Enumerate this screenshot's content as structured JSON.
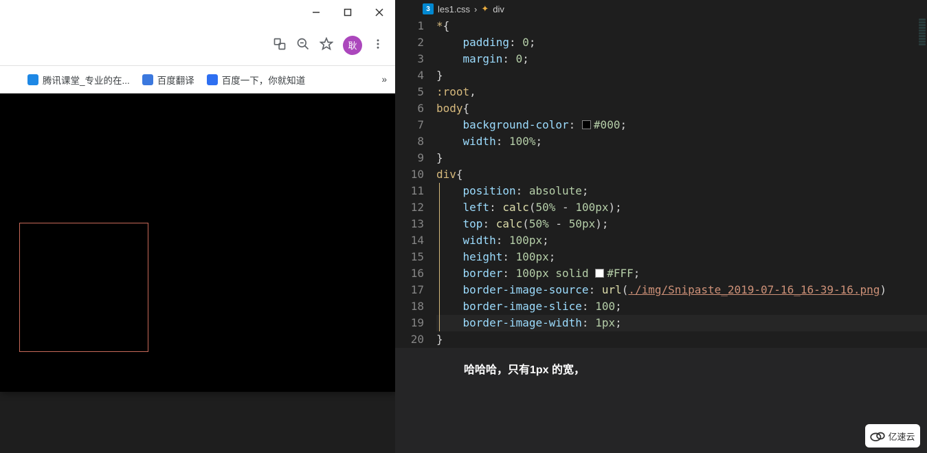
{
  "browser": {
    "bookmarks": [
      {
        "label": "腾讯课堂_专业的在...",
        "color": "#1e88e5"
      },
      {
        "label": "百度翻译",
        "color": "#3b78de"
      },
      {
        "label": "百度一下，你就知道",
        "color": "#2e6ff1"
      }
    ],
    "avatar_char": "耿",
    "overflow": "»"
  },
  "breadcrumb": {
    "file": "les1.css",
    "selector": "div",
    "css_badge": "3",
    "sep": "›"
  },
  "code": {
    "lines": [
      {
        "n": 1,
        "t": [
          [
            "sel",
            "*"
          ],
          [
            "punc",
            "{"
          ]
        ]
      },
      {
        "n": 2,
        "t": [
          [
            "pad",
            "    "
          ],
          [
            "prop",
            "padding"
          ],
          [
            "punc",
            ": "
          ],
          [
            "num",
            "0"
          ],
          [
            "punc",
            ";"
          ]
        ]
      },
      {
        "n": 3,
        "t": [
          [
            "pad",
            "    "
          ],
          [
            "prop",
            "margin"
          ],
          [
            "punc",
            ": "
          ],
          [
            "num",
            "0"
          ],
          [
            "punc",
            ";"
          ]
        ]
      },
      {
        "n": 4,
        "t": [
          [
            "punc",
            "}"
          ]
        ]
      },
      {
        "n": 5,
        "t": [
          [
            "sel",
            ":root"
          ],
          [
            "punc",
            ","
          ]
        ]
      },
      {
        "n": 6,
        "t": [
          [
            "sel",
            "body"
          ],
          [
            "punc",
            "{"
          ]
        ]
      },
      {
        "n": 7,
        "t": [
          [
            "pad",
            "    "
          ],
          [
            "prop",
            "background-color"
          ],
          [
            "punc",
            ": "
          ],
          [
            "swatch",
            "black"
          ],
          [
            "num",
            "#000"
          ],
          [
            "punc",
            ";"
          ]
        ]
      },
      {
        "n": 8,
        "t": [
          [
            "pad",
            "    "
          ],
          [
            "prop",
            "width"
          ],
          [
            "punc",
            ": "
          ],
          [
            "num",
            "100%"
          ],
          [
            "punc",
            ";"
          ]
        ]
      },
      {
        "n": 9,
        "t": [
          [
            "punc",
            "}"
          ]
        ]
      },
      {
        "n": 10,
        "t": [
          [
            "sel",
            "div"
          ],
          [
            "punc",
            "{"
          ]
        ]
      },
      {
        "n": 11,
        "t": [
          [
            "pad",
            "    "
          ],
          [
            "prop",
            "position"
          ],
          [
            "punc",
            ": "
          ],
          [
            "num",
            "absolute"
          ],
          [
            "punc",
            ";"
          ]
        ]
      },
      {
        "n": 12,
        "t": [
          [
            "pad",
            "    "
          ],
          [
            "prop",
            "left"
          ],
          [
            "punc",
            ": "
          ],
          [
            "fn",
            "calc"
          ],
          [
            "punc",
            "("
          ],
          [
            "num",
            "50%"
          ],
          [
            "punc",
            " - "
          ],
          [
            "num",
            "100px"
          ],
          [
            "punc",
            ");"
          ]
        ]
      },
      {
        "n": 13,
        "t": [
          [
            "pad",
            "    "
          ],
          [
            "prop",
            "top"
          ],
          [
            "punc",
            ": "
          ],
          [
            "fn",
            "calc"
          ],
          [
            "punc",
            "("
          ],
          [
            "num",
            "50%"
          ],
          [
            "punc",
            " - "
          ],
          [
            "num",
            "50px"
          ],
          [
            "punc",
            ");"
          ]
        ]
      },
      {
        "n": 14,
        "t": [
          [
            "pad",
            "    "
          ],
          [
            "prop",
            "width"
          ],
          [
            "punc",
            ": "
          ],
          [
            "num",
            "100px"
          ],
          [
            "punc",
            ";"
          ]
        ]
      },
      {
        "n": 15,
        "t": [
          [
            "pad",
            "    "
          ],
          [
            "prop",
            "height"
          ],
          [
            "punc",
            ": "
          ],
          [
            "num",
            "100px"
          ],
          [
            "punc",
            ";"
          ]
        ]
      },
      {
        "n": 16,
        "t": [
          [
            "pad",
            "    "
          ],
          [
            "prop",
            "border"
          ],
          [
            "punc",
            ": "
          ],
          [
            "num",
            "100px"
          ],
          [
            "punc",
            " "
          ],
          [
            "num",
            "solid"
          ],
          [
            "punc",
            " "
          ],
          [
            "swatch",
            "white"
          ],
          [
            "num",
            "#FFF"
          ],
          [
            "punc",
            ";"
          ]
        ]
      },
      {
        "n": 17,
        "t": [
          [
            "pad",
            "    "
          ],
          [
            "prop",
            "border-image-source"
          ],
          [
            "punc",
            ": "
          ],
          [
            "fn",
            "url"
          ],
          [
            "punc",
            "("
          ],
          [
            "str",
            "./img/Snipaste_2019-07-16_16-39-16.png"
          ],
          [
            "punc",
            ")"
          ]
        ]
      },
      {
        "n": 18,
        "t": [
          [
            "pad",
            "    "
          ],
          [
            "prop",
            "border-image-slice"
          ],
          [
            "punc",
            ": "
          ],
          [
            "num",
            "100"
          ],
          [
            "punc",
            ";"
          ]
        ]
      },
      {
        "n": 19,
        "t": [
          [
            "pad",
            "    "
          ],
          [
            "prop",
            "border-image-width"
          ],
          [
            "punc",
            ": "
          ],
          [
            "num",
            "1px"
          ],
          [
            "punc",
            ";"
          ]
        ],
        "current": true
      },
      {
        "n": 20,
        "t": [
          [
            "punc",
            "}"
          ]
        ]
      }
    ]
  },
  "annotation": "哈哈哈，只有1px 的宽，",
  "watermark": "亿速云"
}
